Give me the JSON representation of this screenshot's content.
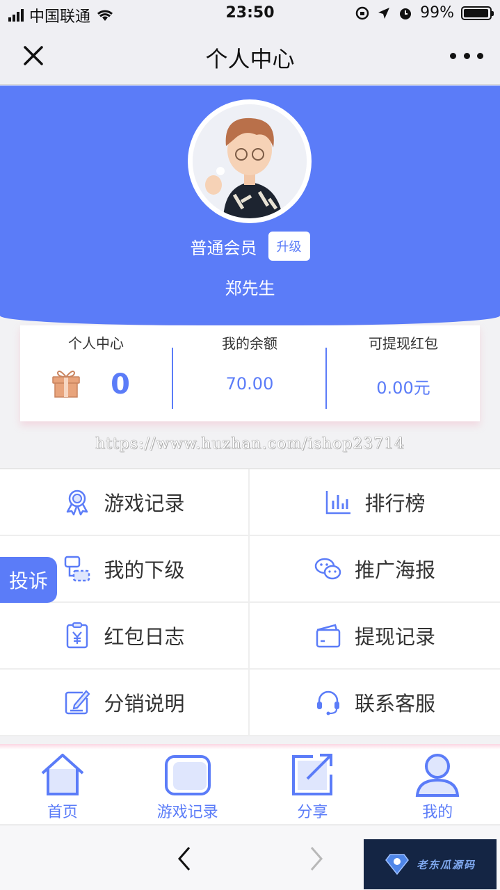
{
  "status_bar": {
    "carrier": "中国联通",
    "time": "23:50",
    "battery": "99%"
  },
  "nav": {
    "title": "个人中心"
  },
  "profile": {
    "member_level": "普通会员",
    "upgrade_label": "升级",
    "name": "郑先生"
  },
  "stats": [
    {
      "label": "个人中心",
      "value": "0"
    },
    {
      "label": "我的余额",
      "value": "70.00"
    },
    {
      "label": "可提现红包",
      "value": "0.00元"
    }
  ],
  "watermark": "https://www.huzhan.com/ishop23714",
  "menu": [
    {
      "label": "游戏记录",
      "icon": "medal-icon"
    },
    {
      "label": "排行榜",
      "icon": "bar-chart-icon"
    },
    {
      "label": "我的下级",
      "icon": "hierarchy-icon"
    },
    {
      "label": "推广海报",
      "icon": "wechat-icon"
    },
    {
      "label": "红包日志",
      "icon": "yuan-clipboard-icon"
    },
    {
      "label": "提现记录",
      "icon": "wallet-icon"
    },
    {
      "label": "分销说明",
      "icon": "edit-icon"
    },
    {
      "label": "联系客服",
      "icon": "headset-icon"
    }
  ],
  "complaint_label": "投诉",
  "tabs": [
    {
      "label": "首页",
      "icon": "home-icon"
    },
    {
      "label": "游戏记录",
      "icon": "game-record-icon"
    },
    {
      "label": "分享",
      "icon": "share-icon"
    },
    {
      "label": "我的",
      "icon": "user-icon"
    }
  ],
  "brand": {
    "text": "老东瓜源码"
  },
  "colors": {
    "accent": "#5b7cf8",
    "gift": "#e8a47c"
  }
}
